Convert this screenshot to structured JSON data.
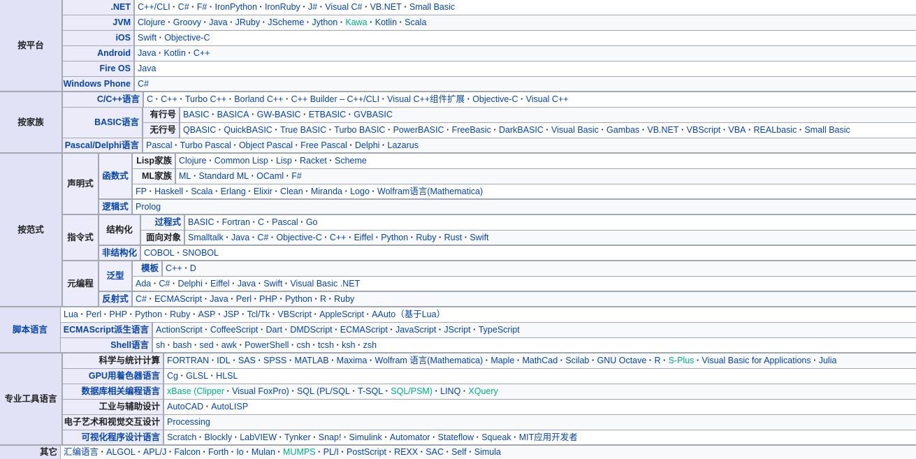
{
  "groups": {
    "platform": {
      "title": "按平台",
      "rows": [
        {
          "label": ".NET",
          "items": [
            "C++/CLI",
            "C#",
            "F#",
            "IronPython",
            "IronRuby",
            "J#",
            "Visual C#",
            "VB.NET",
            "Small Basic"
          ]
        },
        {
          "label": "JVM",
          "items": [
            "Clojure",
            "Groovy",
            "Java",
            "JRuby",
            "JScheme",
            "Jython",
            "Kawa",
            "Kotlin",
            "Scala"
          ]
        },
        {
          "label": "iOS",
          "items": [
            "Swift",
            "Objective-C"
          ]
        },
        {
          "label": "Android",
          "items": [
            "Java",
            "Kotlin",
            "C++"
          ]
        },
        {
          "label": "Fire OS",
          "items": [
            "Java"
          ]
        },
        {
          "label": "Windows Phone",
          "items": [
            "C#"
          ]
        }
      ]
    },
    "family": {
      "title": "按家族",
      "cfam": {
        "label": "C/C++语言",
        "items": [
          "C",
          "C++",
          "Turbo C++",
          "Borland C++",
          "C++ Builder – C++/CLI",
          "Visual C++组件扩展",
          "Objective-C",
          "Visual C++"
        ]
      },
      "basic": {
        "label": "BASIC语言",
        "numbered": {
          "label": "有行号",
          "items": [
            "BASIC",
            "BASICA",
            "GW-BASIC",
            "ETBASIC",
            "GVBASIC"
          ]
        },
        "unnumbered": {
          "label": "无行号",
          "items": [
            "QBASIC",
            "QuickBASIC",
            "True BASIC",
            "Turbo BASIC",
            "PowerBASIC",
            "FreeBasic",
            "DarkBASIC",
            "Visual Basic",
            "Gambas",
            "VB.NET",
            "VBScript",
            "VBA",
            "REALbasic",
            "Small Basic"
          ]
        }
      },
      "pascal": {
        "label": "Pascal/Delphi语言",
        "items": [
          "Pascal",
          "Turbo Pascal",
          "Object Pascal",
          "Free Pascal",
          "Delphi",
          "Lazarus"
        ]
      }
    },
    "paradigm": {
      "title": "按范式",
      "declarative": {
        "label": "声明式",
        "functional": {
          "label": "函数式",
          "lisp": {
            "label": "Lisp家族",
            "items": [
              "Clojure",
              "Common Lisp",
              "Lisp",
              "Racket",
              "Scheme"
            ]
          },
          "ml": {
            "label": "ML家族",
            "items": [
              "ML",
              "Standard ML",
              "OCaml",
              "F#"
            ]
          },
          "other": {
            "items": [
              "FP",
              "Haskell",
              "Scala",
              "Erlang",
              "Elixir",
              "Clean",
              "Miranda",
              "Logo",
              "Wolfram语言(Mathematica)"
            ]
          }
        },
        "logic": {
          "label": "逻辑式",
          "items": [
            "Prolog"
          ]
        }
      },
      "imperative": {
        "label": "指令式",
        "structured": {
          "label": "结构化",
          "procedural": {
            "label": "过程式",
            "items": [
              "BASIC",
              "Fortran",
              "C",
              "Pascal",
              "Go"
            ]
          },
          "oo": {
            "label": "面向对象",
            "items": [
              "Smalltalk",
              "Java",
              "C#",
              "Objective-C",
              "C++",
              "Eiffel",
              "Python",
              "Ruby",
              "Rust",
              "Swift"
            ]
          }
        },
        "unstructured": {
          "label": "非结构化",
          "items": [
            "COBOL",
            "SNOBOL"
          ]
        }
      },
      "meta": {
        "label": "元编程",
        "generic": {
          "label": "泛型",
          "template": {
            "label": "模板",
            "items": [
              "C++",
              "D"
            ]
          },
          "other": {
            "items": [
              "Ada",
              "C#",
              "Delphi",
              "Eiffel",
              "Java",
              "Swift",
              "Visual Basic .NET"
            ]
          }
        },
        "reflective": {
          "label": "反射式",
          "items": [
            "C#",
            "ECMAScript",
            "Java",
            "Perl",
            "PHP",
            "Python",
            "R",
            "Ruby"
          ]
        }
      }
    },
    "scripting": {
      "title": "脚本语言",
      "main": {
        "items": [
          "Lua",
          "Perl",
          "PHP",
          "Python",
          "Ruby",
          "ASP",
          "JSP",
          "Tcl/Tk",
          "VBScript",
          "AppleScript",
          "AAuto（基于Lua）"
        ]
      },
      "ecma": {
        "label": "ECMAScript派生语言",
        "items": [
          "ActionScript",
          "CoffeeScript",
          "Dart",
          "DMDScript",
          "ECMAScript",
          "JavaScript",
          "JScript",
          "TypeScript"
        ]
      },
      "shell": {
        "label": "Shell语言",
        "items": [
          "sh",
          "bash",
          "sed",
          "awk",
          "PowerShell",
          "csh",
          "tcsh",
          "ksh",
          "zsh"
        ]
      }
    },
    "special": {
      "title": "专业工具语言",
      "rows": [
        {
          "label": "科学与统计计算",
          "items": [
            "FORTRAN",
            "IDL",
            "SAS",
            "SPSS",
            "MATLAB",
            "Maxima",
            "Wolfram 语言(Mathematica)",
            "Maple",
            "MathCad",
            "Scilab",
            "GNU Octave",
            "R",
            "S-Plus",
            "Visual Basic for Applications",
            "Julia"
          ]
        },
        {
          "label": "GPU用着色器语言",
          "items": [
            "Cg",
            "GLSL",
            "HLSL"
          ]
        },
        {
          "label": "数据库相关编程语言",
          "items": [
            "xBase (Clipper",
            "Visual FoxPro)",
            "SQL (PL/SQL",
            "T-SQL",
            "SQL/PSM)",
            "LINQ",
            "XQuery"
          ]
        },
        {
          "label": "工业与辅助设计",
          "items": [
            "AutoCAD",
            "AutoLISP"
          ]
        },
        {
          "label": "电子艺术和视觉交互设计",
          "items": [
            "Processing"
          ]
        },
        {
          "label": "可视化程序设计语言",
          "items": [
            "Scratch",
            "Blockly",
            "LabVIEW",
            "Tynker",
            "Snap!",
            "Simulink",
            "Automator",
            "Stateflow",
            "Squeak",
            "MIT应用开发者"
          ]
        }
      ]
    },
    "other": {
      "title": "其它",
      "items": [
        "汇编语言",
        "ALGOL",
        "APL/J",
        "Falcon",
        "Forth",
        "Io",
        "Mulan",
        "MUMPS",
        "PL/I",
        "PostScript",
        "REXX",
        "SAC",
        "Self",
        "Simula"
      ]
    }
  },
  "colors": {
    "link": "#0645ad",
    "link_green": "#00af89",
    "group_bg": "#e2e2f6",
    "list_alt": "#f8f9fa",
    "border": "#a2a9b1"
  }
}
